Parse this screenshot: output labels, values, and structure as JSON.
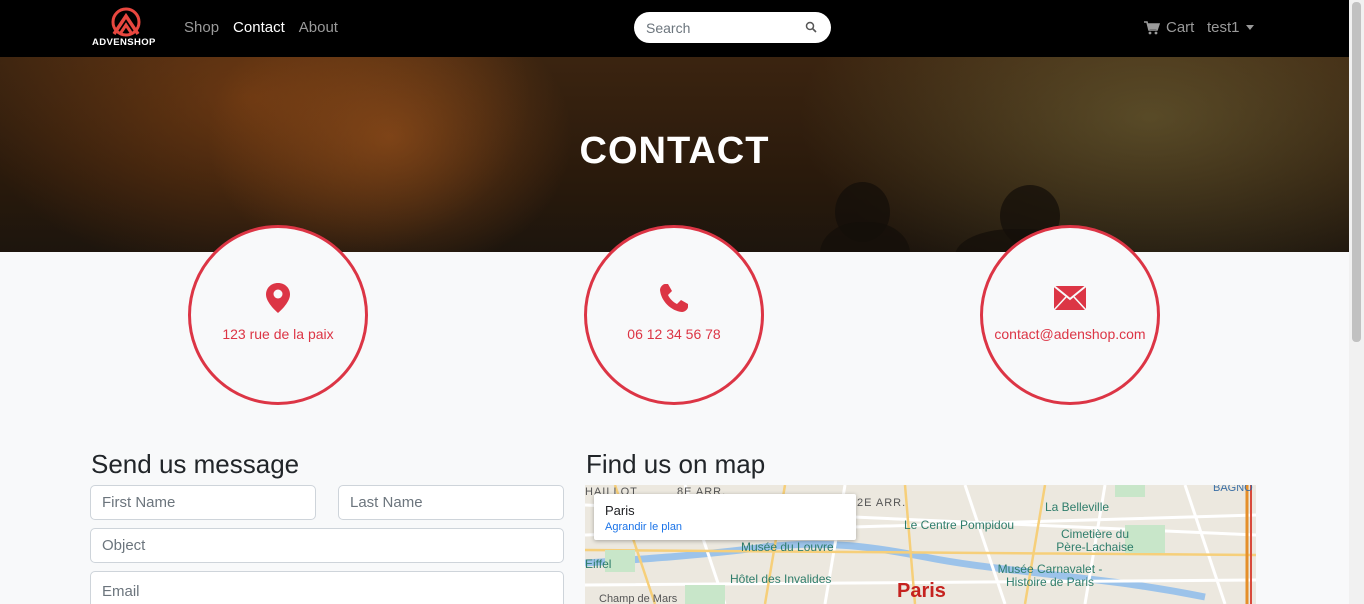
{
  "nav": {
    "logo_text": "ADVENSHOP",
    "links": [
      {
        "label": "Shop"
      },
      {
        "label": "Contact"
      },
      {
        "label": "About"
      }
    ],
    "search_placeholder": "Search",
    "cart_label": "Cart",
    "user_label": "test1"
  },
  "hero": {
    "title": "CONTACT"
  },
  "contact": {
    "address": "123 rue de la paix",
    "phone": "06 12 34 56 78",
    "email": "contact@adenshop.com"
  },
  "form": {
    "title": "Send us message",
    "first_name_placeholder": "First Name",
    "last_name_placeholder": "Last Name",
    "object_placeholder": "Object",
    "email_placeholder": "Email"
  },
  "map": {
    "title": "Find us on map",
    "card_title": "Paris",
    "card_link": "Agrandir le plan",
    "labels": {
      "l1": "8E ARR.",
      "l2": "2E ARR.",
      "l3": "La Belleville",
      "l4": "Le Centre Pompidou",
      "l5": "Cimetière du Père-Lachaise",
      "l6": "Musée du Louvre",
      "l7": "Hôtel des Invalides",
      "l8": "Musée Carnavalet - Histoire de Paris",
      "l9": "Paris",
      "l10": "Champ de Mars",
      "l11": "Eiffel",
      "l12": "BAGNO",
      "l13": "HAILLOT"
    }
  },
  "colors": {
    "accent": "#dc3545",
    "navbar": "#000000",
    "page_bg": "#f8f9fa"
  }
}
